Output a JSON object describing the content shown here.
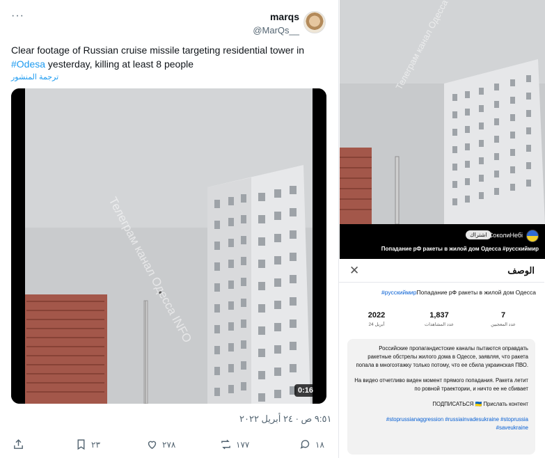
{
  "tweet": {
    "more_label": "···",
    "author_name": "marqs",
    "author_handle": "@MarQs__",
    "text_before": "Clear footage of Russian cruise missile targeting residential tower in ",
    "hashtag": "#Odesa",
    "text_after": " yesterday, killing at least 8 people",
    "translate_label": "ترجمة المنشور",
    "video_watermark": "Телеграм канал Одесса INFO",
    "video_duration": "0:16",
    "timestamp": "٩:٥١ ص · ٢٤ أبريل ٢٠٢٢",
    "actions": {
      "share": "",
      "bookmarks": "٢٣",
      "likes": "٢٧٨",
      "retweets": "١٧٧",
      "replies": "١٨"
    }
  },
  "right_panel": {
    "video_watermark": "Телеграм канал Одесса INFO",
    "channel_name": "@СоколиНебі",
    "subscribe_label": "اشتراك",
    "video_title": "Попадание рФ ракеты в жилой дом Одесса #русскиймир",
    "description_header": "الوصف",
    "close_label": "✕",
    "title_text": "Попадание рФ ракеты в жилой дом Одесса",
    "title_tag": "#русскиймир",
    "stats": [
      {
        "value": "7",
        "label": "عدد المعجبين"
      },
      {
        "value": "1,837",
        "label": "عدد المشاهدات"
      },
      {
        "value": "2022",
        "label": "24 أبريل"
      }
    ],
    "description": {
      "p1": "Российские пропагандистские каналы пытаются оправдать ракетные обстрелы жилого дома в Одессе, заявляя, что ракета попала в многоэтажку только потому, что ее сбила украинская ПВО.",
      "p2": "На видео отчетливо виден момент прямого попадания. Ракета летит по ровной траектории, и ничто ее не сбивает",
      "p3": "ПОДПИСАТЬСЯ 🇺🇦 Прислать контент",
      "tags": "#stoprussianaggression #russiainvadesukraine #stoprussia #saveukraine"
    }
  },
  "colors": {
    "link_blue": "#1d9bf0",
    "yt_blue": "#065fd4",
    "muted": "#536471"
  }
}
